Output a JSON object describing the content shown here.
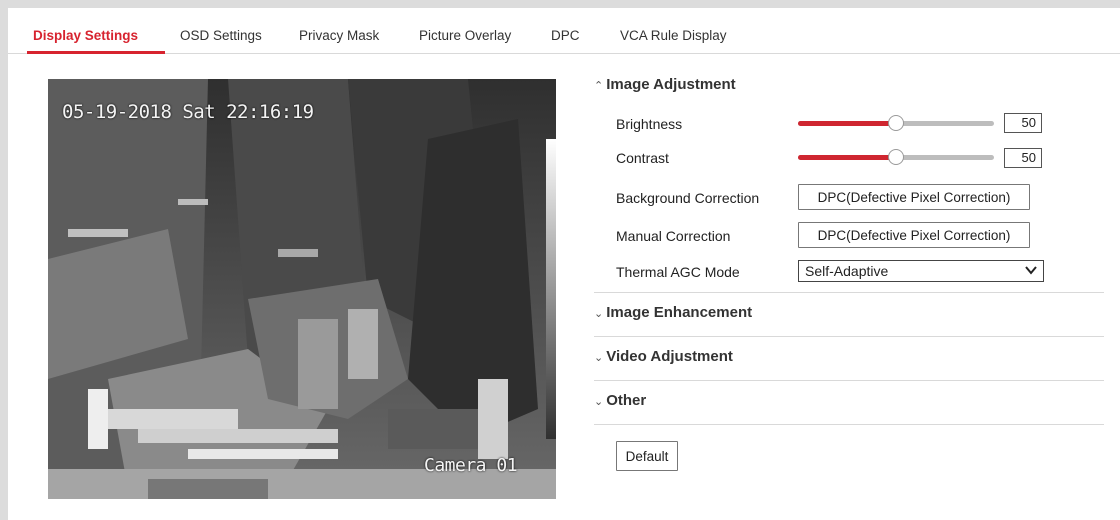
{
  "tabs": [
    {
      "label": "Display Settings",
      "active": true
    },
    {
      "label": "OSD Settings"
    },
    {
      "label": "Privacy Mask"
    },
    {
      "label": "Picture Overlay"
    },
    {
      "label": "DPC"
    },
    {
      "label": "VCA Rule Display"
    }
  ],
  "video": {
    "timestamp": "05-19-2018 Sat 22:16:19",
    "camera_name": "Camera 01"
  },
  "image_adjustment": {
    "title": "Image Adjustment",
    "brightness": {
      "label": "Brightness",
      "value": "50"
    },
    "contrast": {
      "label": "Contrast",
      "value": "50"
    },
    "background_correction": {
      "label": "Background Correction",
      "button": "DPC(Defective Pixel Correction)"
    },
    "manual_correction": {
      "label": "Manual Correction",
      "button": "DPC(Defective Pixel Correction)"
    },
    "agc_mode": {
      "label": "Thermal AGC Mode",
      "selected": "Self-Adaptive"
    }
  },
  "sections": {
    "image_enhancement": "Image Enhancement",
    "video_adjustment": "Video Adjustment",
    "other": "Other"
  },
  "default_button": "Default",
  "colors": {
    "accent": "#d7232f",
    "slider_fill": "#cf2630"
  }
}
